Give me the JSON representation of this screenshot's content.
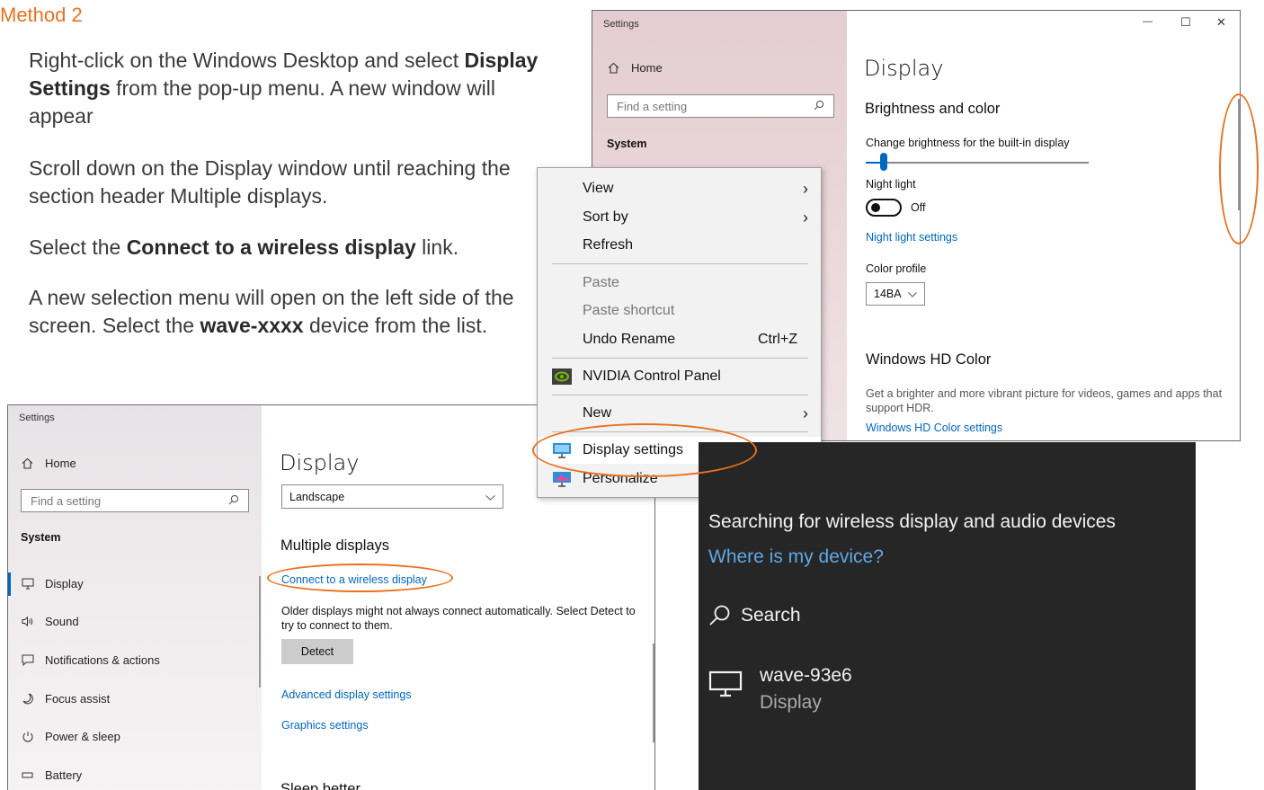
{
  "instructions": {
    "title": "Method 2",
    "steps": [
      {
        "num": ".",
        "pre": "Right-click on the Windows Desktop and select ",
        "bold": "Display Settings",
        "post": " from the pop-up menu. A new window will appear"
      },
      {
        "num": ".",
        "pre": "Scroll down on the Display window until reaching the section header Multiple displays.",
        "bold": "",
        "post": ""
      },
      {
        "num": ".",
        "pre": "Select the ",
        "bold": "Connect to a wireless display",
        "post": " link."
      },
      {
        "num": ".",
        "pre": "A new selection menu will open on the left side of the screen. Select the ",
        "bold": "wave-xxxx",
        "post": " device from the list."
      }
    ]
  },
  "settings_top": {
    "window_title": "Settings",
    "caption": {
      "minimize": "—",
      "maximize": "☐",
      "close": "✕"
    },
    "home": "Home",
    "find_placeholder": "Find a setting",
    "system_label": "System",
    "page_title": "Display",
    "section_brightness": "Brightness and color",
    "brightness_label": "Change brightness for the built-in display",
    "brightness_level": 0.08,
    "night_light_label": "Night light",
    "night_light_state": "Off",
    "night_light_link": "Night light settings",
    "color_profile_label": "Color profile",
    "color_profile_value": "14BA",
    "section_hd": "Windows HD Color",
    "hd_desc": "Get a brighter and more vibrant picture for videos, games and apps that support HDR.",
    "hd_link": "Windows HD Color settings"
  },
  "settings_bottom": {
    "window_title": "Settings",
    "home": "Home",
    "find_placeholder": "Find a setting",
    "system_label": "System",
    "nav": [
      {
        "label": "Display",
        "icon": "monitor-icon"
      },
      {
        "label": "Sound",
        "icon": "speaker-icon"
      },
      {
        "label": "Notifications & actions",
        "icon": "notification-icon"
      },
      {
        "label": "Focus assist",
        "icon": "moon-icon"
      },
      {
        "label": "Power & sleep",
        "icon": "power-icon"
      },
      {
        "label": "Battery",
        "icon": "battery-icon"
      }
    ],
    "page_title": "Display",
    "orientation_value": "Landscape",
    "section_multi": "Multiple displays",
    "wireless_link": "Connect to a wireless display",
    "older_desc": "Older displays might not always connect automatically. Select Detect to try to connect to them.",
    "detect_button": "Detect",
    "advanced_link": "Advanced display settings",
    "graphics_link": "Graphics settings",
    "next_section": "Sleep better"
  },
  "context_menu": {
    "items": [
      {
        "label": "View",
        "arrow": true
      },
      {
        "label": "Sort by",
        "arrow": true
      },
      {
        "label": "Refresh"
      },
      {
        "label": "Paste",
        "disabled": true
      },
      {
        "label": "Paste shortcut",
        "disabled": true
      },
      {
        "label": "Undo Rename",
        "shortcut": "Ctrl+Z"
      },
      {
        "label": "NVIDIA Control Panel",
        "icon": "nvidia-icon"
      },
      {
        "label": "New",
        "arrow": true
      },
      {
        "label": "Display settings",
        "icon": "display-settings-icon"
      },
      {
        "label": "Personalize",
        "icon": "personalize-icon"
      }
    ],
    "arrow_glyph": "›"
  },
  "wireless_panel": {
    "searching": "Searching for wireless display and audio devices",
    "where_link": "Where is my device?",
    "search_label": "Search",
    "device_name": "wave-93e6",
    "device_type": "Display"
  },
  "colors": {
    "accent_orange": "#e8711f",
    "link_blue": "#0067c0",
    "dark_panel": "#262626"
  }
}
